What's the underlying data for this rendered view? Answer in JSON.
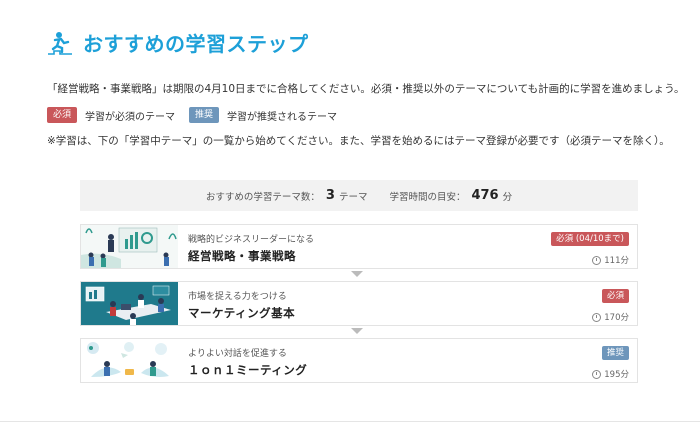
{
  "page": {
    "title": "おすすめの学習ステップ",
    "intro": "「経営戦略・事業戦略」は期限の4月10日までに合格してください。必須・推奨以外のテーマについても計画的に学習を進めましょう。",
    "note": "※学習は、下の「学習中テーマ」の一覧から始めてください。また、学習を始めるにはテーマ登録が必要です（必須テーマを除く）。"
  },
  "legend": {
    "required_tag": "必須",
    "required_text": "学習が必須のテーマ",
    "recommended_tag": "推奨",
    "recommended_text": "学習が推奨されるテーマ"
  },
  "summary": {
    "count_label": "おすすめの学習テーマ数：",
    "count_value": "3",
    "count_unit": "テーマ",
    "time_label": "学習時間の目安：",
    "time_value": "476",
    "time_unit": "分"
  },
  "courses": [
    {
      "subtitle": "戦略的ビジネスリーダーになる",
      "title": "経営戦略・事業戦略",
      "tag": "必須 (04/10まで)",
      "tag_type": "required",
      "duration": "111分"
    },
    {
      "subtitle": "市場を捉える力をつける",
      "title": "マーケティング基本",
      "tag": "必須",
      "tag_type": "required",
      "duration": "170分"
    },
    {
      "subtitle": "よりよい対話を促進する",
      "title": "１ｏｎ１ミーティング",
      "tag": "推奨",
      "tag_type": "recommended",
      "duration": "195分"
    }
  ],
  "colors": {
    "accent": "#1da0d8",
    "required": "#c9575a",
    "recommended": "#6e96bb",
    "summary_bg": "#f2f2f2"
  },
  "icons": [
    "stairs-icon",
    "clock-icon"
  ]
}
